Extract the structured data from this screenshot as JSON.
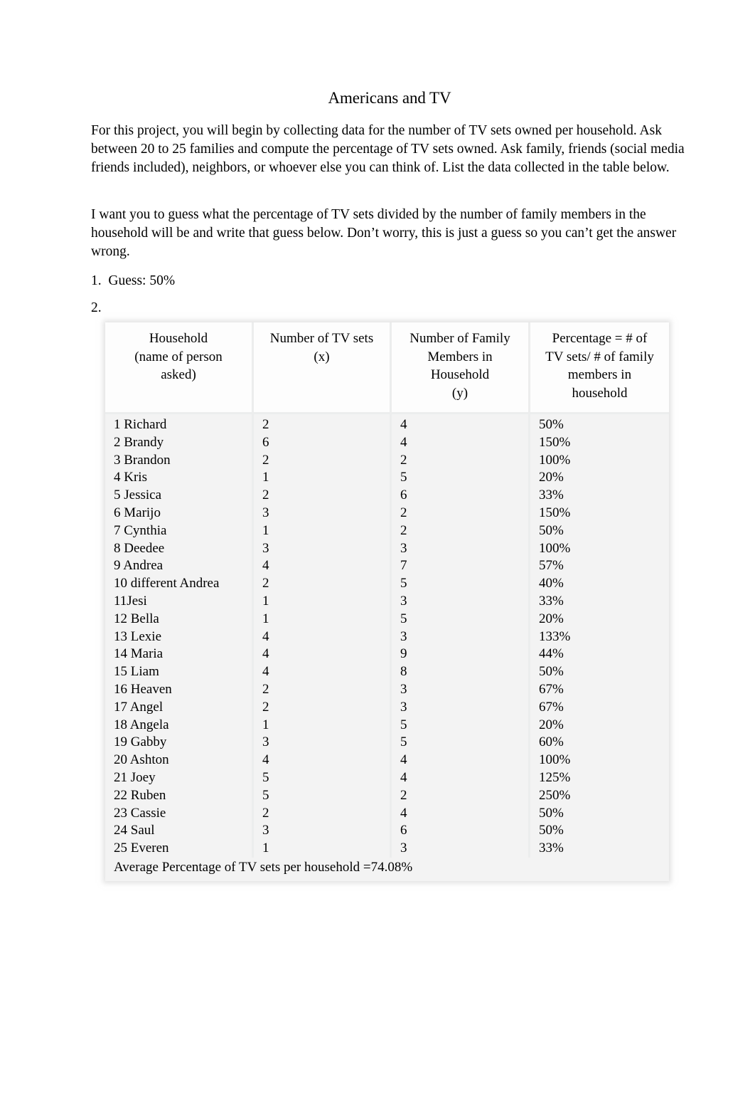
{
  "document": {
    "title": "Americans and TV",
    "paragraphs": [
      "For this project, you will begin by collecting data for the number of TV sets owned per household.  Ask between 20 to 25 families and compute the percentage of TV sets owned. Ask family, friends (social media friends included), neighbors, or whoever else you can think of.  List the data collected in the table below.",
      "I want you to guess what the percentage of TV sets divided by the number of family members in the household will be and write that guess below.  Don’t worry, this is just a guess so you can’t get the answer wrong."
    ],
    "list_items": [
      "1.  Guess: 50%",
      "2."
    ]
  },
  "table": {
    "headers": [
      "Household\n(name of person asked)",
      "Number of TV sets\n(x)",
      "Number of Family Members in Household\n(y)",
      "Percentage = # of TV sets/ # of family members  in household"
    ],
    "header_lines": {
      "col1": [
        "Household",
        "(name of person",
        "asked)"
      ],
      "col2": [
        "Number of TV sets",
        "(x)"
      ],
      "col3": [
        "Number of Family",
        "Members in",
        "Household",
        "(y)"
      ],
      "col4": [
        "Percentage = # of",
        "TV sets/ # of family",
        "members  in",
        "household"
      ]
    },
    "rows": [
      {
        "household": "1 Richard",
        "tv_sets": "2",
        "family_members": "4",
        "percentage": "50%"
      },
      {
        "household": "2 Brandy",
        "tv_sets": "6",
        "family_members": "4",
        "percentage": "150%"
      },
      {
        "household": "3 Brandon",
        "tv_sets": "2",
        "family_members": "2",
        "percentage": "100%"
      },
      {
        "household": "4 Kris",
        "tv_sets": "1",
        "family_members": "5",
        "percentage": "20%"
      },
      {
        "household": "5 Jessica",
        "tv_sets": "2",
        "family_members": "6",
        "percentage": "33%"
      },
      {
        "household": "6 Marijo",
        "tv_sets": "3",
        "family_members": "2",
        "percentage": "150%"
      },
      {
        "household": "7 Cynthia",
        "tv_sets": "1",
        "family_members": "2",
        "percentage": "50%"
      },
      {
        "household": "8 Deedee",
        "tv_sets": "3",
        "family_members": "3",
        "percentage": "100%"
      },
      {
        "household": "9 Andrea",
        "tv_sets": "4",
        "family_members": "7",
        "percentage": "57%"
      },
      {
        "household": "10 different Andrea",
        "tv_sets": "2",
        "family_members": "5",
        "percentage": "40%"
      },
      {
        "household": "11Jesi",
        "tv_sets": "1",
        "family_members": "3",
        "percentage": "33%"
      },
      {
        "household": "12 Bella",
        "tv_sets": "1",
        "family_members": "5",
        "percentage": "20%"
      },
      {
        "household": "13 Lexie",
        "tv_sets": "4",
        "family_members": "3",
        "percentage": "133%"
      },
      {
        "household": "14 Maria",
        "tv_sets": "4",
        "family_members": "9",
        "percentage": "44%"
      },
      {
        "household": "15 Liam",
        "tv_sets": "4",
        "family_members": "8",
        "percentage": "50%"
      },
      {
        "household": "16 Heaven",
        "tv_sets": "2",
        "family_members": "3",
        "percentage": "67%"
      },
      {
        "household": "17 Angel",
        "tv_sets": "2",
        "family_members": "3",
        "percentage": "67%"
      },
      {
        "household": "18 Angela",
        "tv_sets": "1",
        "family_members": "5",
        "percentage": "20%"
      },
      {
        "household": "19 Gabby",
        "tv_sets": "3",
        "family_members": "5",
        "percentage": "60%"
      },
      {
        "household": "20 Ashton",
        "tv_sets": "4",
        "family_members": "4",
        "percentage": "100%"
      },
      {
        "household": "21 Joey",
        "tv_sets": "5",
        "family_members": "4",
        "percentage": "125%"
      },
      {
        "household": "22 Ruben",
        "tv_sets": "5",
        "family_members": "2",
        "percentage": "250%"
      },
      {
        "household": "23 Cassie",
        "tv_sets": "2",
        "family_members": "4",
        "percentage": "50%"
      },
      {
        "household": "24 Saul",
        "tv_sets": "3",
        "family_members": "6",
        "percentage": "50%"
      },
      {
        "household": "25 Everen",
        "tv_sets": "1",
        "family_members": "3",
        "percentage": "33%"
      }
    ],
    "average_row": "Average Percentage of TV sets per household =74.08%"
  }
}
